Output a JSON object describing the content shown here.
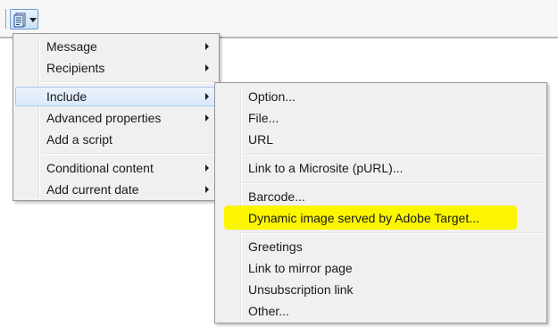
{
  "toolbar": {
    "button_icon": "document-insert-icon"
  },
  "main_menu": {
    "items": [
      {
        "label": "Message",
        "submenu": true
      },
      {
        "label": "Recipients",
        "submenu": true
      },
      {
        "label": "Include",
        "submenu": true,
        "active": true
      },
      {
        "label": "Advanced properties",
        "submenu": true
      },
      {
        "label": "Add a script",
        "submenu": false
      },
      {
        "label": "Conditional content",
        "submenu": true
      },
      {
        "label": "Add current date",
        "submenu": true
      }
    ]
  },
  "include_submenu": {
    "items": [
      {
        "label": "Option..."
      },
      {
        "label": "File..."
      },
      {
        "label": "URL"
      },
      {
        "label": "Link to a Microsite (pURL)..."
      },
      {
        "label": "Barcode..."
      },
      {
        "label": "Dynamic image served by Adobe Target...",
        "highlighted": true
      },
      {
        "label": "Greetings"
      },
      {
        "label": "Link to mirror page"
      },
      {
        "label": "Unsubscription link"
      },
      {
        "label": "Other..."
      }
    ],
    "highlight_color": "#fbf500"
  }
}
